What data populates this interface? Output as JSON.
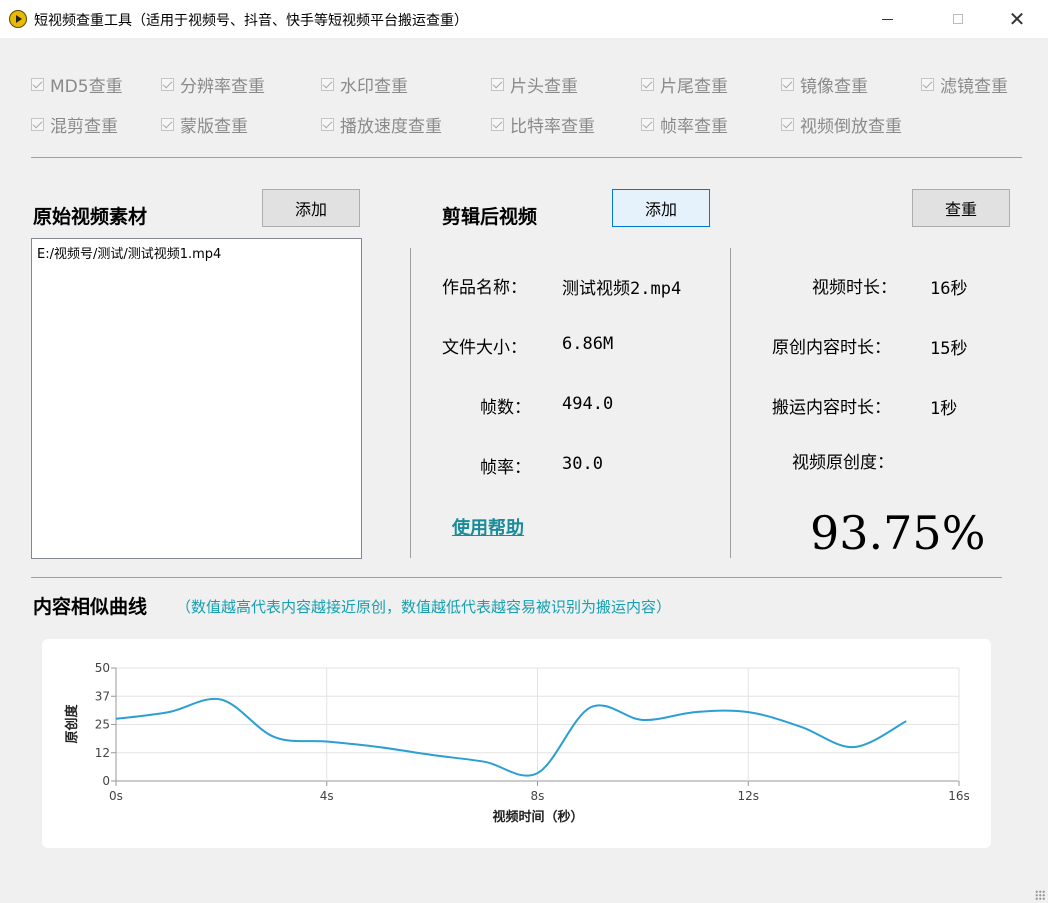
{
  "window": {
    "title": "短视频查重工具（适用于视频号、抖音、快手等短视频平台搬运查重）",
    "close_symbol": "✕"
  },
  "checks": [
    {
      "label": "MD5查重",
      "checked": true
    },
    {
      "label": "分辨率查重",
      "checked": true
    },
    {
      "label": "水印查重",
      "checked": true
    },
    {
      "label": "片头查重",
      "checked": true
    },
    {
      "label": "片尾查重",
      "checked": true
    },
    {
      "label": "镜像查重",
      "checked": true
    },
    {
      "label": "滤镜查重",
      "checked": true
    },
    {
      "label": "混剪查重",
      "checked": true
    },
    {
      "label": "蒙版查重",
      "checked": true
    },
    {
      "label": "播放速度查重",
      "checked": true
    },
    {
      "label": "比特率查重",
      "checked": true
    },
    {
      "label": "帧率查重",
      "checked": true
    },
    {
      "label": "视频倒放查重",
      "checked": true
    }
  ],
  "original": {
    "heading": "原始视频素材",
    "add_label": "添加",
    "files": [
      "E:/视频号/测试/测试视频1.mp4"
    ]
  },
  "edited": {
    "heading": "剪辑后视频",
    "add_label": "添加",
    "check_label": "查重",
    "name_label": "作品名称：",
    "name_value": "测试视频2.mp4",
    "size_label": "文件大小：",
    "size_value": "6.86M",
    "frames_label": "帧数：",
    "frames_value": "494.0",
    "fps_label": "帧率：",
    "fps_value": "30.0",
    "help_link": "使用帮助"
  },
  "stats": {
    "duration_label": "视频时长：",
    "duration_value": "16秒",
    "original_label": "原创内容时长：",
    "original_value": "15秒",
    "copied_label": "搬运内容时长：",
    "copied_value": "1秒",
    "originality_label": "视频原创度：",
    "originality_value": "93.75%"
  },
  "curve": {
    "title": "内容相似曲线",
    "note": "（数值越高代表内容越接近原创，数值越低代表越容易被识别为搬运内容）"
  },
  "chart_data": {
    "type": "line",
    "xlabel": "视频时间（秒）",
    "ylabel": "原创度",
    "xlim": [
      0,
      16
    ],
    "ylim": [
      0,
      50
    ],
    "xticks": [
      "0s",
      "4s",
      "8s",
      "12s",
      "16s"
    ],
    "yticks": [
      "50",
      "37",
      "25",
      "12",
      "0"
    ],
    "ytick_values": [
      50,
      37.5,
      25,
      12.5,
      0
    ],
    "grid": true,
    "line_color": "#2b9fd3",
    "x": [
      0,
      1,
      2,
      3,
      4,
      5,
      6,
      7,
      8,
      9,
      10,
      11,
      12,
      13,
      14,
      15
    ],
    "y": [
      27.5,
      30.5,
      36,
      19.5,
      17.5,
      15,
      11.5,
      8.5,
      3.5,
      32.5,
      27,
      30.5,
      30.5,
      24,
      15,
      26.5
    ]
  }
}
